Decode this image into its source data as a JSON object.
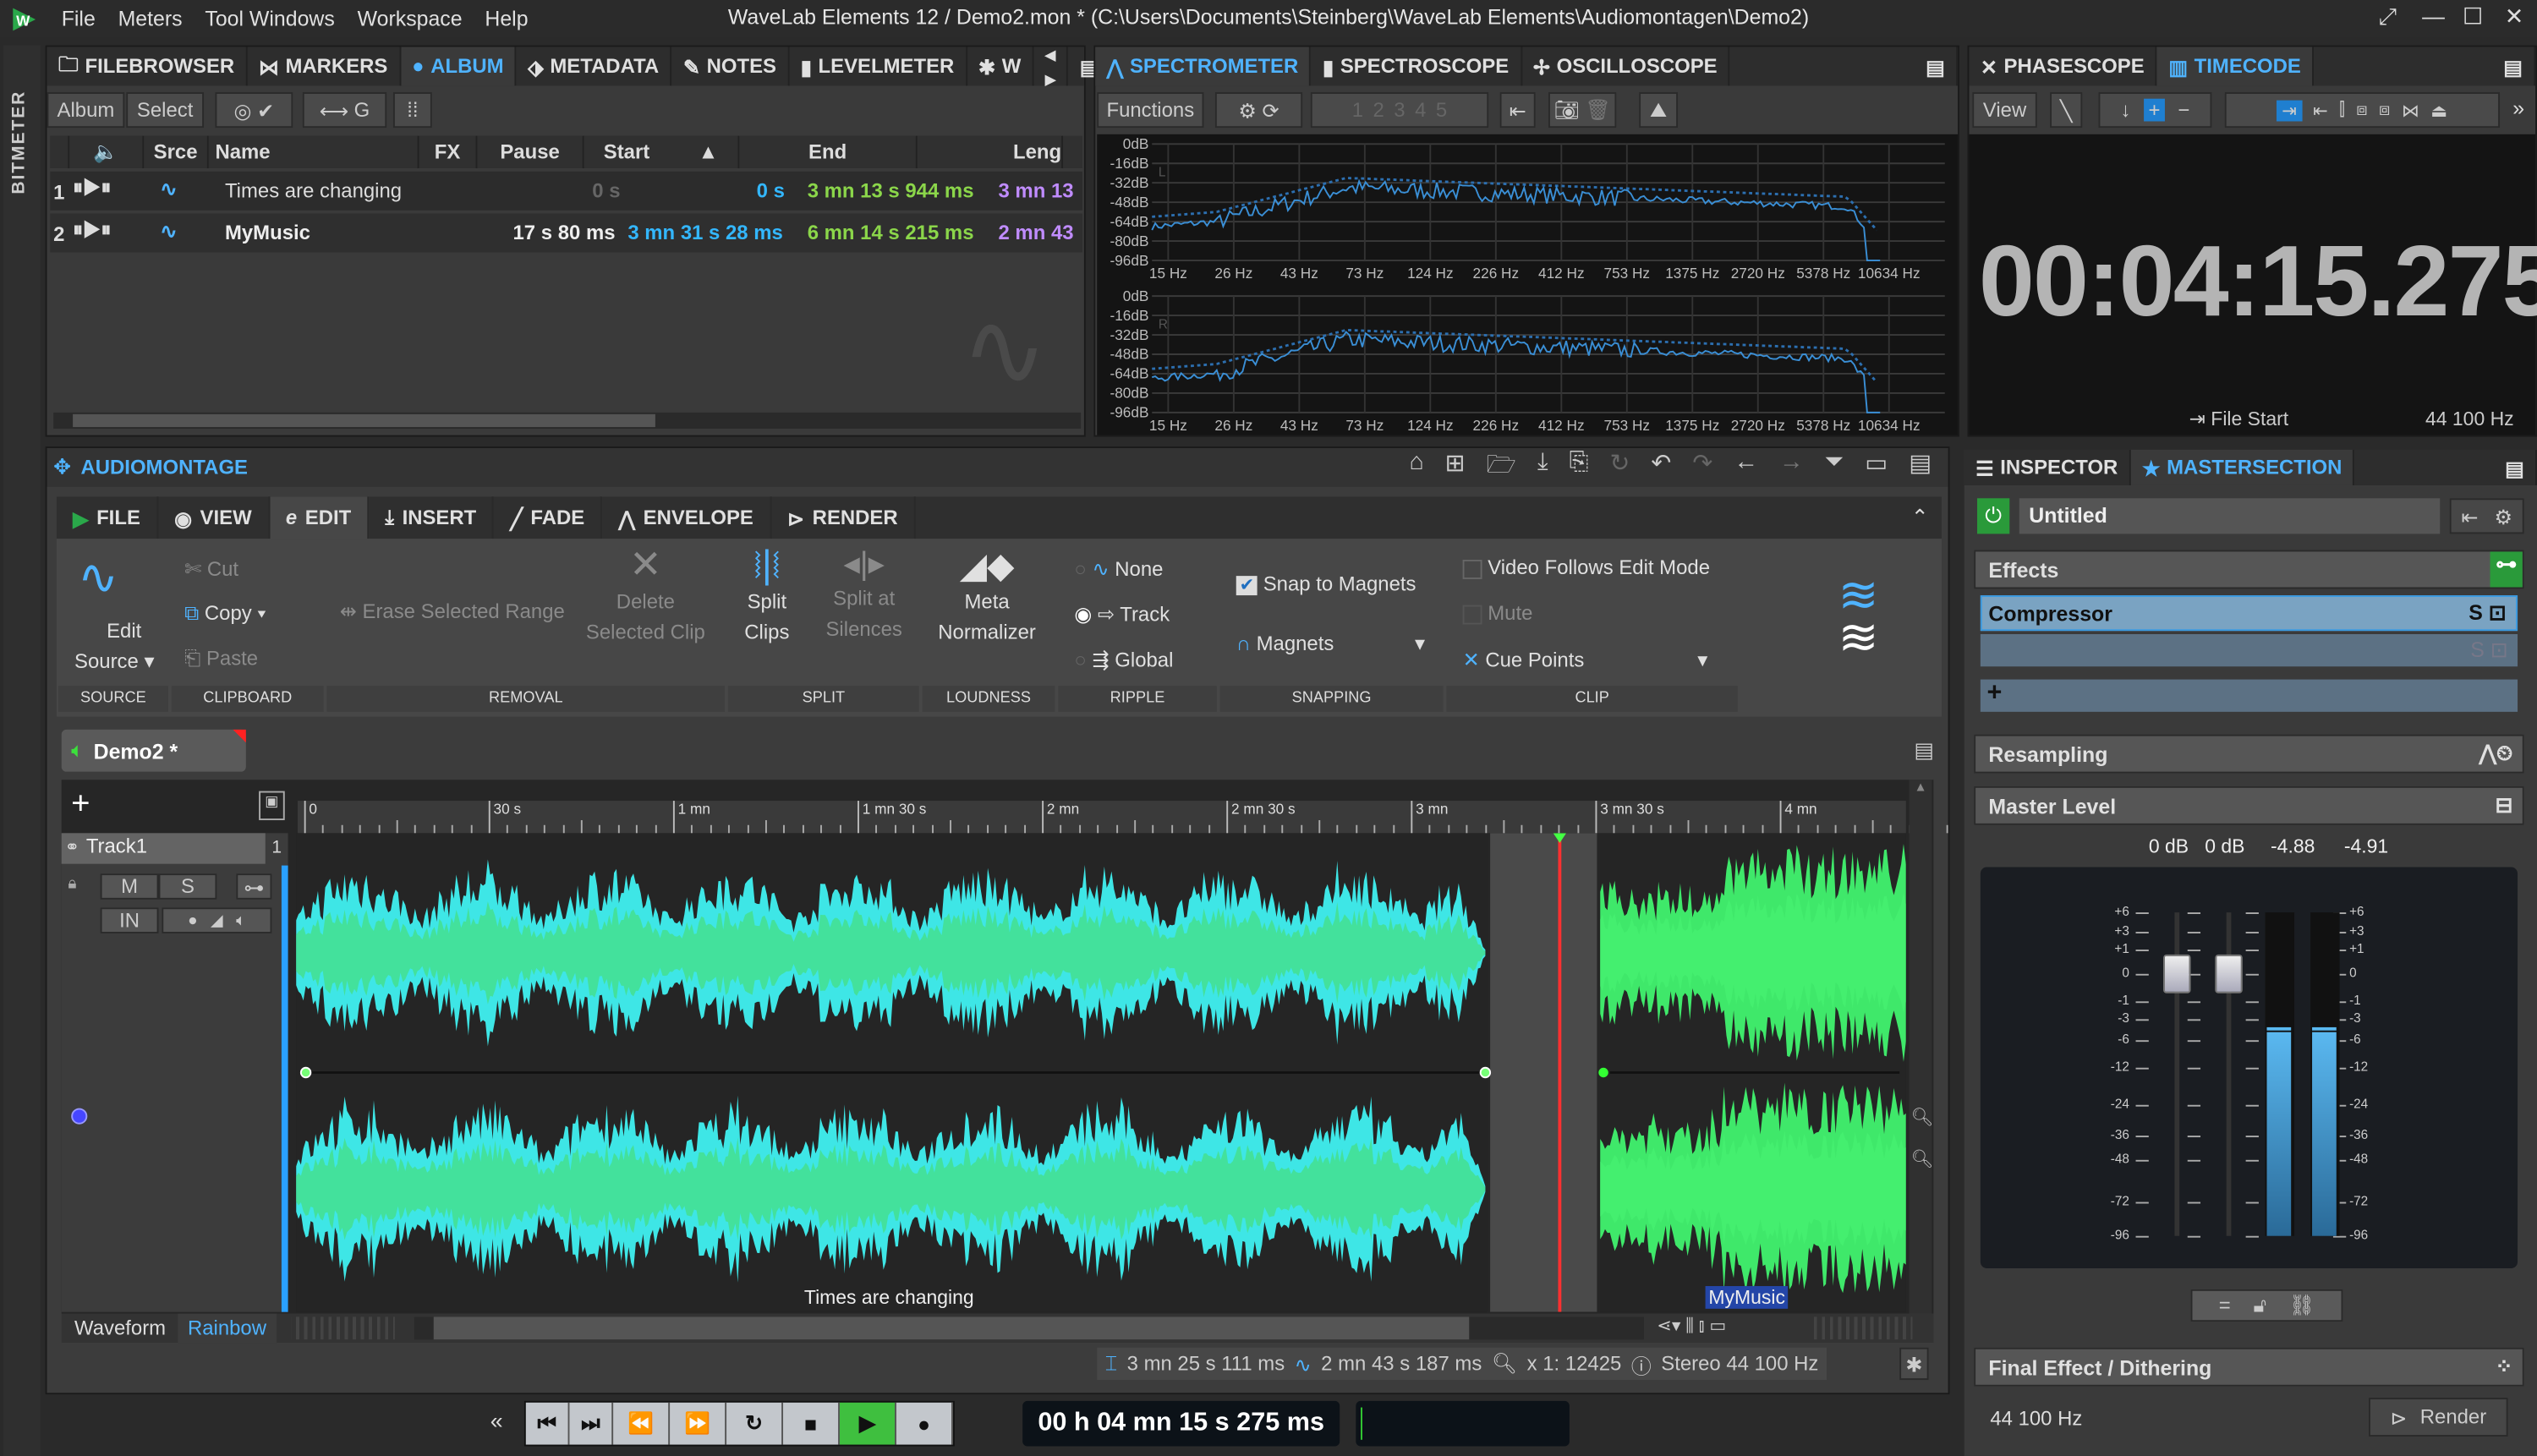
{
  "app": {
    "title": "WaveLab Elements 12 / Demo2.mon * (C:\\Users\\Documents\\Steinberg\\WaveLab Elements\\Audiomontagen\\Demo2)",
    "menu": [
      "File",
      "Meters",
      "Tool Windows",
      "Workspace",
      "Help"
    ]
  },
  "sidebar": {
    "label": "BITMETER"
  },
  "album": {
    "tabs": [
      "FILEBROWSER",
      "MARKERS",
      "ALBUM",
      "METADATA",
      "NOTES",
      "LEVELMETER",
      "W"
    ],
    "active_tab": "ALBUM",
    "toolbar": {
      "album": "Album",
      "select": "Select"
    },
    "columns": [
      "Srce",
      "Name",
      "FX",
      "Pause",
      "Start",
      "End",
      "Leng"
    ],
    "rows": [
      {
        "num": "1",
        "name": "Times are changing",
        "pause": "0 s",
        "start": "0 s",
        "end": "3 mn 13 s 944 ms",
        "length": "3 mn 13"
      },
      {
        "num": "2",
        "name": "MyMusic",
        "pause": "17 s 80 ms",
        "start": "3 mn 31 s 28 ms",
        "end": "6 mn 14 s 215 ms",
        "length": "2 mn 43"
      }
    ]
  },
  "meters": {
    "tabs": [
      "SPECTROMETER",
      "SPECTROSCOPE",
      "OSCILLOSCOPE"
    ],
    "active_tab": "SPECTROMETER",
    "functions": "Functions",
    "presets": [
      "1",
      "2",
      "3",
      "4",
      "5"
    ],
    "db_labels": [
      "0dB",
      "-16dB",
      "-32dB",
      "-48dB",
      "-64dB",
      "-80dB",
      "-96dB"
    ],
    "freq_labels": [
      "15 Hz",
      "26 Hz",
      "43 Hz",
      "73 Hz",
      "124 Hz",
      "226 Hz",
      "412 Hz",
      "753 Hz",
      "1375 Hz",
      "2720 Hz",
      "5378 Hz",
      "10634 Hz"
    ],
    "channels": [
      "L",
      "R"
    ]
  },
  "timecode": {
    "tabs": [
      "PHASESCOPE",
      "TIMECODE"
    ],
    "active_tab": "TIMECODE",
    "view": "View",
    "value": "00:04:15.275",
    "reference": "File Start",
    "rate": "44 100 Hz"
  },
  "montage": {
    "title": "AUDIOMONTAGE",
    "ribbon_tabs": [
      "FILE",
      "VIEW",
      "EDIT",
      "INSERT",
      "FADE",
      "ENVELOPE",
      "RENDER"
    ],
    "active_tab": "EDIT",
    "ribbon": {
      "edit_source": [
        "Edit",
        "Source"
      ],
      "cut": "Cut",
      "copy": "Copy",
      "paste": "Paste",
      "erase": "Erase Selected Range",
      "delete": [
        "Delete",
        "Selected Clip"
      ],
      "split_clips": [
        "Split",
        "Clips"
      ],
      "split_silences": [
        "Split at",
        "Silences"
      ],
      "meta_normalizer": [
        "Meta",
        "Normalizer"
      ],
      "ripple_none": "None",
      "ripple_track": "Track",
      "ripple_global": "Global",
      "ripple_selected": "Track",
      "snap_to_magnets": "Snap to Magnets",
      "snap_checked": true,
      "magnets": "Magnets",
      "video_follows": "Video Follows Edit Mode",
      "mute": "Mute",
      "cue_points": "Cue Points",
      "groups": [
        "SOURCE",
        "CLIPBOARD",
        "REMOVAL",
        "SPLIT",
        "LOUDNESS",
        "RIPPLE",
        "SNAPPING",
        "CLIP"
      ]
    },
    "doc_tab": "Demo2 *",
    "ruler": [
      "0",
      "30 s",
      "1 mn",
      "1 mn 30 s",
      "2 mn",
      "2 mn 30 s",
      "3 mn",
      "3 mn 30 s",
      "4 mn"
    ],
    "track": {
      "name": "Track1",
      "number": "1",
      "mute": "M",
      "solo": "S",
      "input": "IN"
    },
    "clips": [
      {
        "name": "Times are changing"
      },
      {
        "name": "MyMusic"
      }
    ],
    "view_mode": {
      "waveform": "Waveform",
      "rainbow": "Rainbow"
    },
    "status": {
      "cursor": "3 mn 25 s 111 ms",
      "length": "2 mn 43 s 187 ms",
      "zoom": "x 1: 12425",
      "format": "Stereo 44 100 Hz"
    },
    "colors": {
      "waveform_cyan": "#3ee6e6",
      "waveform_green": "#3fe86a",
      "cursor": "#ff3030",
      "accent": "#4fb3ff"
    }
  },
  "transport": {
    "time": "00 h 04 mn 15 s 275 ms",
    "playing": true
  },
  "inspector": {
    "tabs": [
      "INSPECTOR",
      "MASTERSECTION"
    ],
    "active_tab": "MASTERSECTION",
    "preset": "Untitled",
    "effects_label": "Effects",
    "slots": [
      "Compressor",
      ""
    ],
    "resampling": "Resampling",
    "master_level": "Master Level",
    "level_readouts": [
      "0 dB",
      "0 dB",
      "-4.88",
      "-4.91"
    ],
    "scale": [
      "+6",
      "+3",
      "+1",
      "0",
      "-1",
      "-3",
      "-6",
      "-12",
      "-24",
      "-36",
      "-48",
      "-72",
      "-96"
    ],
    "peak_db": [
      -4.88,
      -4.91
    ],
    "fader_db": [
      0,
      0
    ],
    "final_effect": "Final Effect / Dithering",
    "rate": "44 100 Hz",
    "render": "Render"
  }
}
